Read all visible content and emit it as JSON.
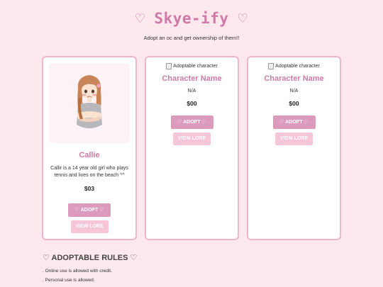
{
  "header": {
    "title": "♡ Skye-ify ♡",
    "tagline": "Adopt an oc and get ownership of them!!"
  },
  "cards": [
    {
      "name": "Callie",
      "description": "Callir is a 14 year old girl who plays tennis and lives on the beach ^^",
      "price": "$03",
      "adopt_label": "♡ ADOPT ♡",
      "lore_label": "VIEW LORE"
    },
    {
      "image_alt": "Adoptable character",
      "name": "Character Name",
      "description": "N/A",
      "price": "$00",
      "adopt_label": "♡ ADOPT ♡",
      "lore_label": "VIEW LORE"
    },
    {
      "image_alt": "Adoptable character",
      "name": "Character Name",
      "description": "N/A",
      "price": "$00",
      "adopt_label": "♡ ADOPT ♡",
      "lore_label": "VIEW LORE"
    }
  ],
  "rules": {
    "title": "♡ ADOPTABLE RULES ♡",
    "items": [
      ". Online use is allowed with credit.",
      ". Personal use is allowed."
    ]
  }
}
